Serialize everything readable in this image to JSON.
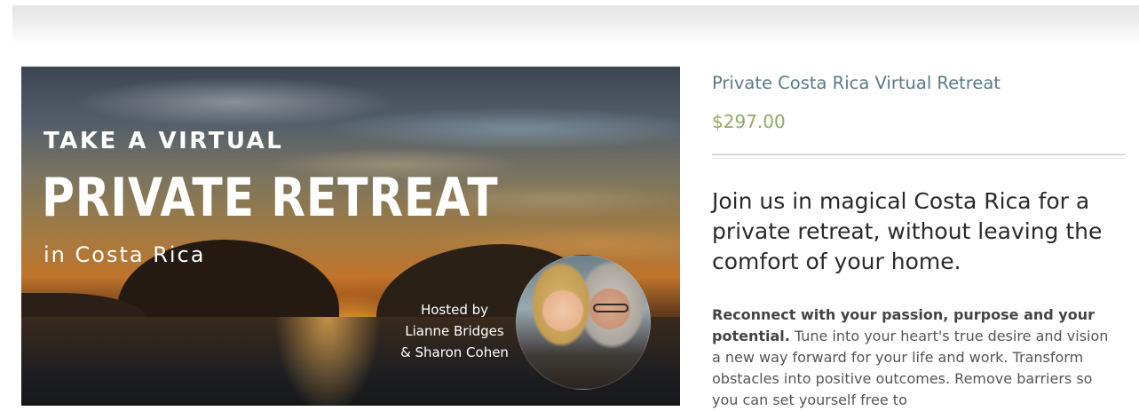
{
  "hero": {
    "kicker": "TAKE A VIRTUAL",
    "title": "PRIVATE RETREAT",
    "subtitle": "in Costa Rica",
    "hosted_lines": [
      "Hosted by",
      "Lianne Bridges",
      "& Sharon Cohen"
    ]
  },
  "product": {
    "title": "Private Costa Rica Virtual Retreat",
    "price": "$297.00",
    "headline": "Join us in magical Costa Rica for a private retreat, without leaving the comfort of your home.",
    "description_bold": "Reconnect with your passion, purpose and your potential.",
    "description_rest": " Tune into your heart's true desire and vision a new way forward for your life and work. Transform obstacles into positive outcomes. Remove barriers so you can set yourself free to"
  },
  "colors": {
    "title": "#5c7a85",
    "price": "#8fa964",
    "headline": "#2a2a2a",
    "body": "#555555"
  }
}
